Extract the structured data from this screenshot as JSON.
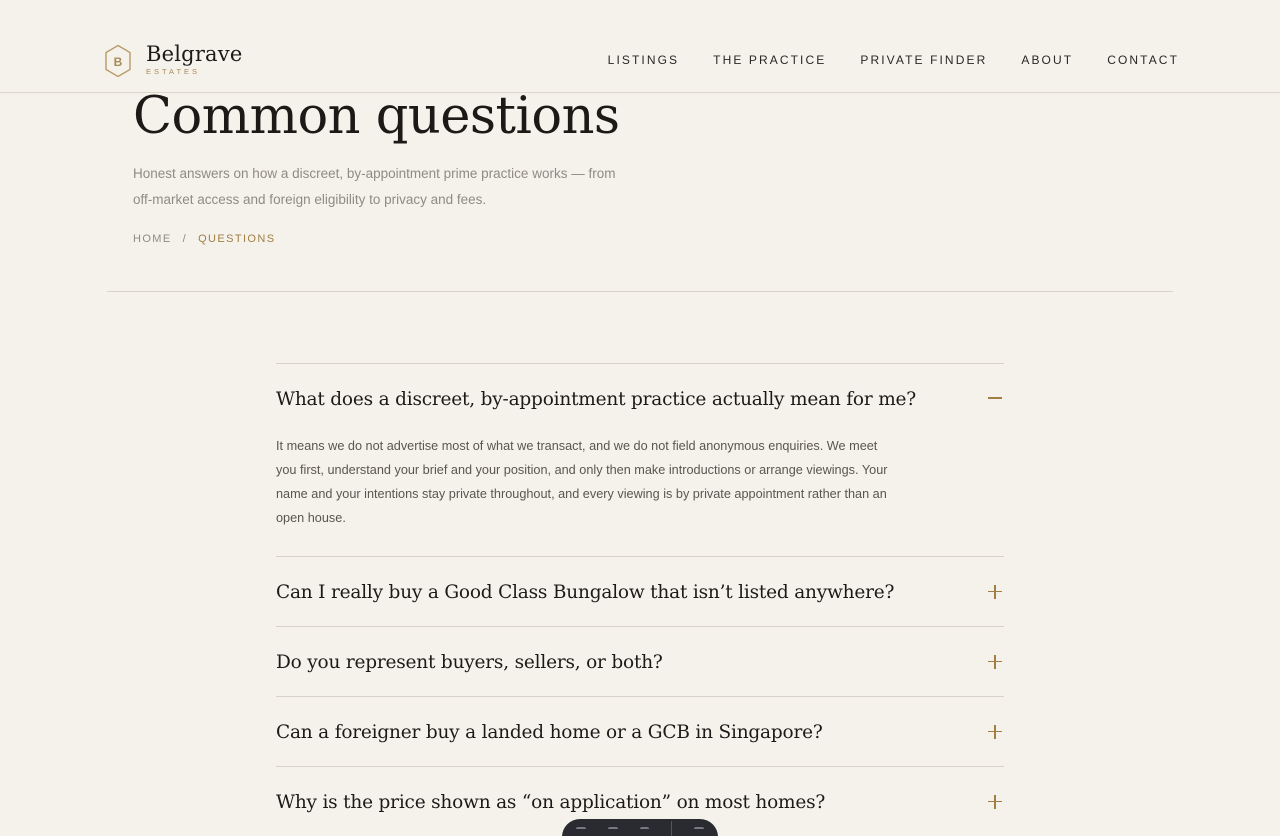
{
  "header": {
    "brand_name": "Belgrave",
    "brand_sub": "ESTATES",
    "brand_letter": "B",
    "nav": [
      {
        "label": "LISTINGS"
      },
      {
        "label": "THE PRACTICE"
      },
      {
        "label": "PRIVATE FINDER"
      },
      {
        "label": "ABOUT"
      },
      {
        "label": "CONTACT"
      }
    ]
  },
  "hero": {
    "title": "Common questions",
    "subtitle": "Honest answers on how a discreet, by-appointment prime practice works — from off-market access and foreign eligibility to privacy and fees.",
    "breadcrumb": {
      "home": "HOME",
      "separator": "/",
      "current": "QUESTIONS"
    }
  },
  "faq": {
    "items": [
      {
        "question": "What does a discreet, by-appointment practice actually mean for me?",
        "answer": "It means we do not advertise most of what we transact, and we do not field anonymous enquiries. We meet you first, understand your brief and your position, and only then make introductions or arrange viewings. Your name and your intentions stay private throughout, and every viewing is by private appointment rather than an open house.",
        "open": true
      },
      {
        "question": "Can I really buy a Good Class Bungalow that isn’t listed anywhere?",
        "open": false
      },
      {
        "question": "Do you represent buyers, sellers, or both?",
        "open": false
      },
      {
        "question": "Can a foreigner buy a landed home or a GCB in Singapore?",
        "open": false
      },
      {
        "question": "Why is the price shown as “on application” on most homes?",
        "open": false
      }
    ]
  },
  "colors": {
    "background": "#f5f2ec",
    "accent": "#a07e44",
    "text": "#1c1a17",
    "muted": "#8f8b84",
    "divider": "#d8d2c8"
  },
  "icons": {
    "logo": "hexagon-logo-icon",
    "collapse": "minus-icon",
    "expand": "plus-icon"
  }
}
